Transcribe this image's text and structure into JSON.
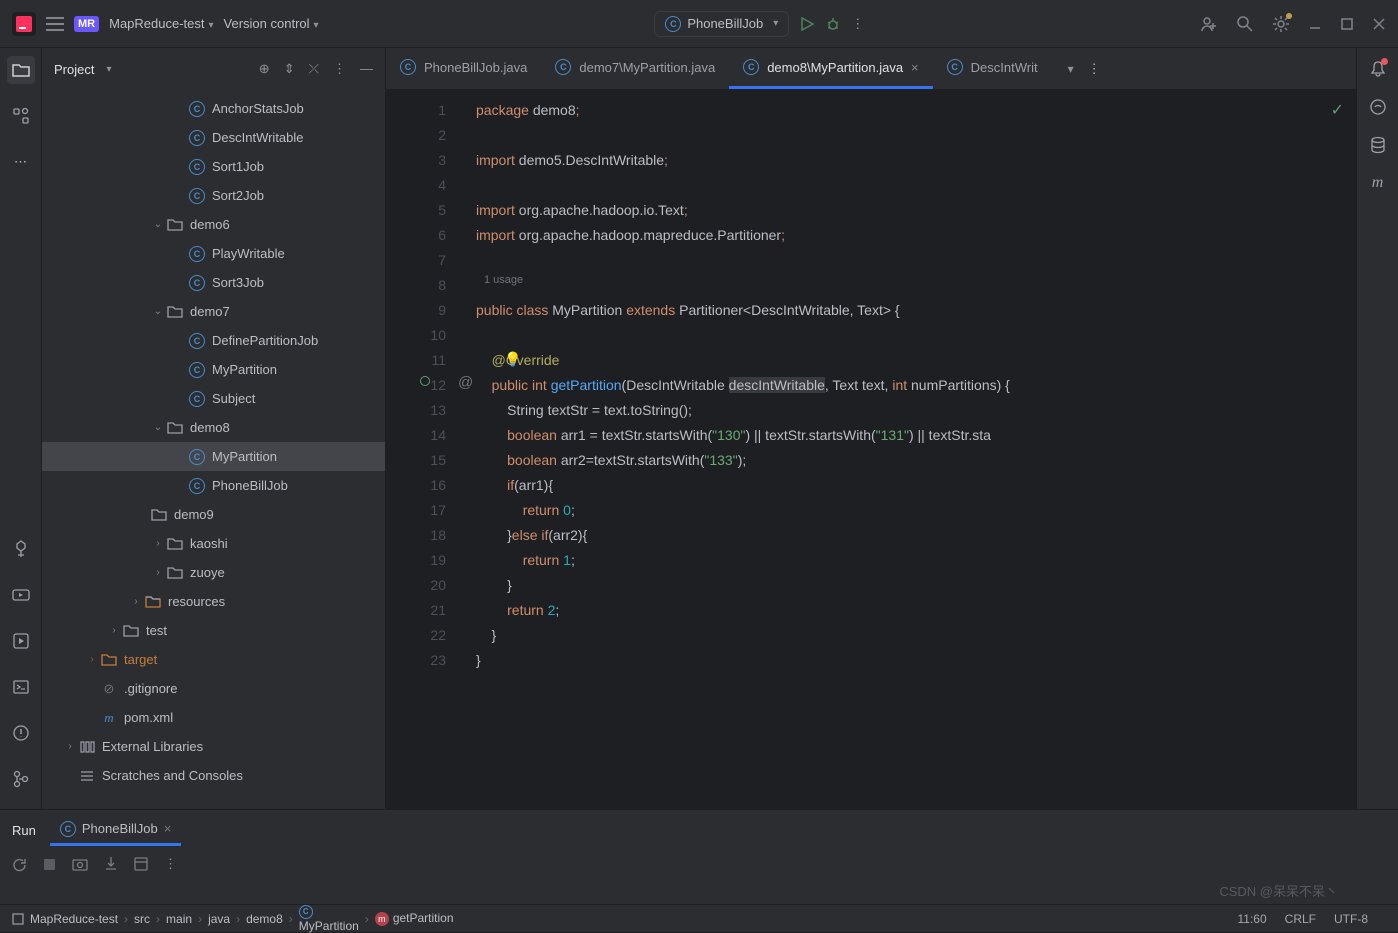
{
  "titlebar": {
    "project": "MapReduce-test",
    "menu_vc": "Version control",
    "run_config": "PhoneBillJob"
  },
  "sidebar": {
    "title": "Project",
    "tree": [
      {
        "depth": 5,
        "type": "class",
        "label": "AnchorStatsJob"
      },
      {
        "depth": 5,
        "type": "class",
        "label": "DescIntWritable"
      },
      {
        "depth": 5,
        "type": "class",
        "label": "Sort1Job"
      },
      {
        "depth": 5,
        "type": "class",
        "label": "Sort2Job"
      },
      {
        "depth": 4,
        "type": "folder",
        "label": "demo6",
        "open": true
      },
      {
        "depth": 5,
        "type": "class",
        "label": "PlayWritable"
      },
      {
        "depth": 5,
        "type": "class",
        "label": "Sort3Job"
      },
      {
        "depth": 4,
        "type": "folder",
        "label": "demo7",
        "open": true
      },
      {
        "depth": 5,
        "type": "class",
        "label": "DefinePartitionJob"
      },
      {
        "depth": 5,
        "type": "class",
        "label": "MyPartition"
      },
      {
        "depth": 5,
        "type": "class",
        "label": "Subject"
      },
      {
        "depth": 4,
        "type": "folder",
        "label": "demo8",
        "open": true
      },
      {
        "depth": 5,
        "type": "class",
        "label": "MyPartition",
        "selected": true
      },
      {
        "depth": 5,
        "type": "class",
        "label": "PhoneBillJob"
      },
      {
        "depth": 4,
        "type": "folder",
        "label": "demo9",
        "open": false,
        "noarrow": true
      },
      {
        "depth": 4,
        "type": "folder",
        "label": "kaoshi",
        "open": false
      },
      {
        "depth": 4,
        "type": "folder",
        "label": "zuoye",
        "open": false
      },
      {
        "depth": 3,
        "type": "resfolder",
        "label": "resources",
        "open": false
      },
      {
        "depth": 2,
        "type": "folder",
        "label": "test",
        "open": false
      },
      {
        "depth": 1,
        "type": "folder",
        "label": "target",
        "open": false,
        "orange": true
      },
      {
        "depth": 1,
        "type": "gitignore",
        "label": ".gitignore"
      },
      {
        "depth": 1,
        "type": "pom",
        "label": "pom.xml"
      },
      {
        "depth": 0,
        "type": "lib",
        "label": "External Libraries",
        "open": false
      },
      {
        "depth": 0,
        "type": "scratch",
        "label": "Scratches and Consoles"
      }
    ]
  },
  "tabs": [
    {
      "label": "PhoneBillJob.java"
    },
    {
      "label": "demo7\\MyPartition.java"
    },
    {
      "label": "demo8\\MyPartition.java",
      "active": true
    },
    {
      "label": "DescIntWrit"
    }
  ],
  "code": {
    "usage": "1 usage",
    "lines": [
      "1",
      "2",
      "3",
      "4",
      "5",
      "6",
      "7",
      "8",
      "9",
      "10",
      "11",
      "12",
      "13",
      "14",
      "15",
      "16",
      "17",
      "18",
      "19",
      "20",
      "21",
      "22",
      "23"
    ]
  },
  "run": {
    "title": "Run",
    "tab": "PhoneBillJob"
  },
  "breadcrumb": [
    "MapReduce-test",
    "src",
    "main",
    "java",
    "demo8",
    "MyPartition",
    "getPartition"
  ],
  "status": {
    "pos": "11:60",
    "eol": "CRLF",
    "enc": "UTF-8"
  },
  "watermark": "CSDN @呆呆不呆丶"
}
